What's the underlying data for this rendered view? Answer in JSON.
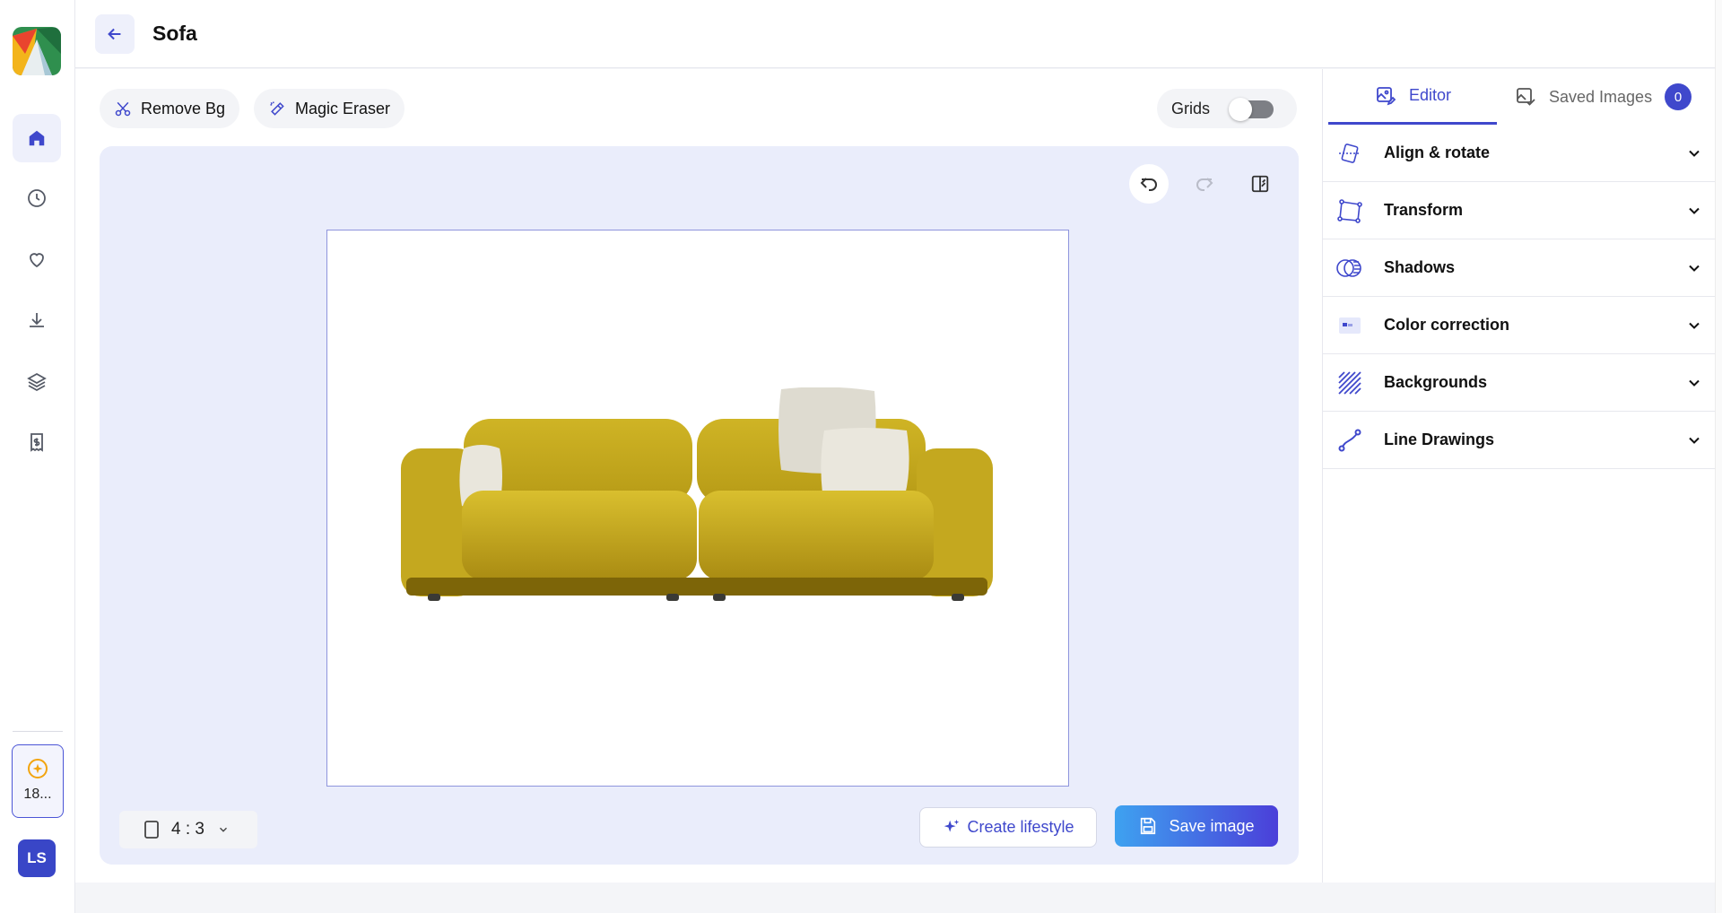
{
  "header": {
    "title": "Sofa"
  },
  "sidebar": {
    "items": [
      {
        "name": "home-icon",
        "active": true
      },
      {
        "name": "history-icon",
        "active": false
      },
      {
        "name": "heart-icon",
        "active": false
      },
      {
        "name": "download-icon",
        "active": false
      },
      {
        "name": "layers-icon",
        "active": false
      },
      {
        "name": "receipt-icon",
        "active": false
      }
    ],
    "credits": "18...",
    "avatar": "LS"
  },
  "toolbar": {
    "remove_bg": "Remove Bg",
    "magic_eraser": "Magic Eraser",
    "grids_label": "Grids",
    "grids_on": false
  },
  "canvas": {
    "aspect_ratio": "4 : 3",
    "create_lifestyle": "Create lifestyle",
    "save_image": "Save image"
  },
  "right_panel": {
    "tabs": [
      {
        "label": "Editor",
        "active": true
      },
      {
        "label": "Saved Images",
        "active": false,
        "badge": "0"
      }
    ],
    "sections": [
      {
        "label": "Align & rotate",
        "icon": "align-rotate-icon"
      },
      {
        "label": "Transform",
        "icon": "transform-icon"
      },
      {
        "label": "Shadows",
        "icon": "shadows-icon"
      },
      {
        "label": "Color correction",
        "icon": "color-correction-icon"
      },
      {
        "label": "Backgrounds",
        "icon": "backgrounds-icon"
      },
      {
        "label": "Line Drawings",
        "icon": "line-drawings-icon"
      }
    ]
  },
  "colors": {
    "accent": "#3f48cc",
    "canvas_bg": "#eaedfb",
    "sofa": "#c9ac1e"
  }
}
